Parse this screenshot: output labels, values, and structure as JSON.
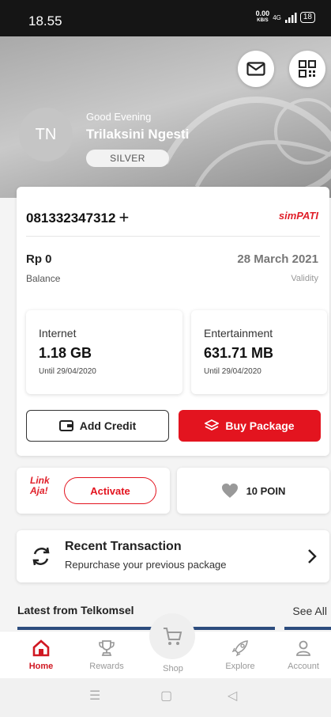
{
  "status_bar": {
    "time": "18.55",
    "speed": "0.00",
    "speed_unit": "KB/S",
    "network": "4G",
    "battery": "18"
  },
  "header": {
    "greeting": "Good Evening",
    "user_name": "Trilaksini Ngesti",
    "avatar_initials": "TN",
    "tier": "SILVER",
    "icons": [
      "mail-icon",
      "qr-code-icon"
    ]
  },
  "account": {
    "phone_number": "081332347312",
    "add_icon_label": "+",
    "brand": "simPATI",
    "balance_value": "Rp 0",
    "balance_label": "Balance",
    "validity_value": "28 March 2021",
    "validity_label": "Validity"
  },
  "quotas": [
    {
      "title": "Internet",
      "value": "1.18 GB",
      "until": "Until 29/04/2020"
    },
    {
      "title": "Entertainment",
      "value": "631.71 MB",
      "until": "Until 29/04/2020"
    }
  ],
  "buttons": {
    "add_credit": "Add Credit",
    "buy_package": "Buy Package"
  },
  "linkaja": {
    "logo_line1": "Link",
    "logo_line2": "Aja!",
    "activate": "Activate"
  },
  "poin": {
    "label": "10 POIN"
  },
  "recent_transaction": {
    "title": "Recent Transaction",
    "subtitle": "Repurchase your previous package"
  },
  "latest": {
    "title": "Latest from Telkomsel",
    "see_all": "See All"
  },
  "bottom_nav": [
    {
      "label": "Home",
      "icon": "home-icon",
      "active": true
    },
    {
      "label": "Rewards",
      "icon": "trophy-icon"
    },
    {
      "label": "Shop",
      "icon": "cart-icon"
    },
    {
      "label": "Explore",
      "icon": "rocket-icon"
    },
    {
      "label": "Account",
      "icon": "person-icon"
    }
  ],
  "colors": {
    "accent": "#e3141f",
    "header_grey": "#b5b5b5",
    "latest_strip": "#2d4c7e"
  }
}
